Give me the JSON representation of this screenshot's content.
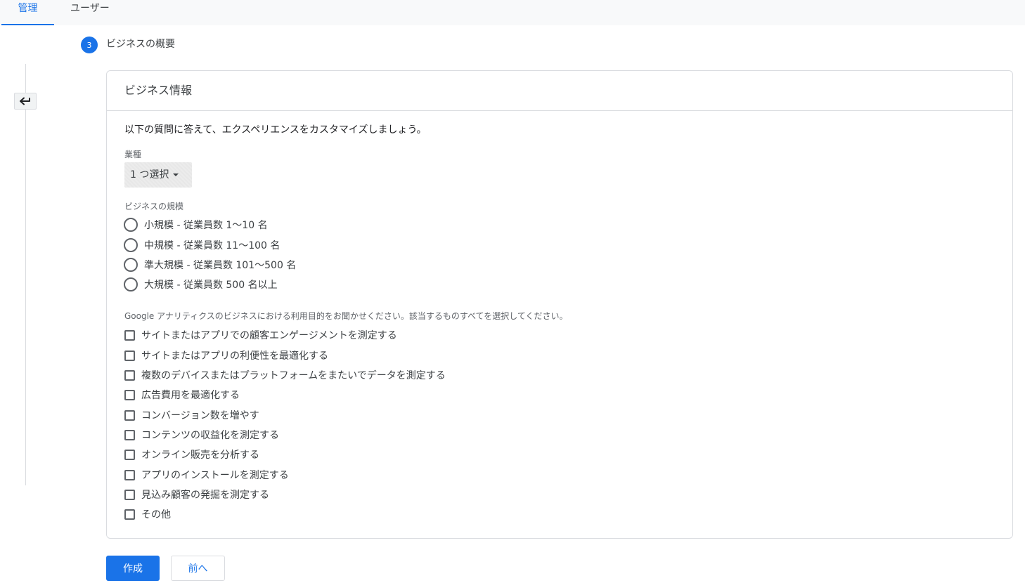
{
  "tabs": {
    "admin": "管理",
    "users": "ユーザー"
  },
  "step": {
    "number": "3",
    "title": "ビジネスの概要"
  },
  "card": {
    "title": "ビジネス情報",
    "intro": "以下の質問に答えて、エクスペリエンスをカスタマイズしましょう。",
    "industry_label": "業種",
    "industry_value": "1 つ選択",
    "size_label": "ビジネスの規模",
    "sizes": [
      "小規模 - 従業員数 1～10 名",
      "中規模 - 従業員数 11～100 名",
      "準大規模 - 従業員数 101～500 名",
      "大規模 - 従業員数 500 名以上"
    ],
    "purpose_label": "Google アナリティクスのビジネスにおける利用目的をお聞かせください。該当するものすべてを選択してください。",
    "purposes": [
      "サイトまたはアプリでの顧客エンゲージメントを測定する",
      "サイトまたはアプリの利便性を最適化する",
      "複数のデバイスまたはプラットフォームをまたいでデータを測定する",
      "広告費用を最適化する",
      "コンバージョン数を増やす",
      "コンテンツの収益化を測定する",
      "オンライン販売を分析する",
      "アプリのインストールを測定する",
      "見込み顧客の発掘を測定する",
      "その他"
    ]
  },
  "buttons": {
    "create": "作成",
    "prev": "前へ"
  },
  "colors": {
    "accent": "#1a73e8",
    "border": "#dadce0"
  },
  "icons": {
    "back": "arrow-back-icon",
    "dropdown": "caret-down-icon"
  }
}
